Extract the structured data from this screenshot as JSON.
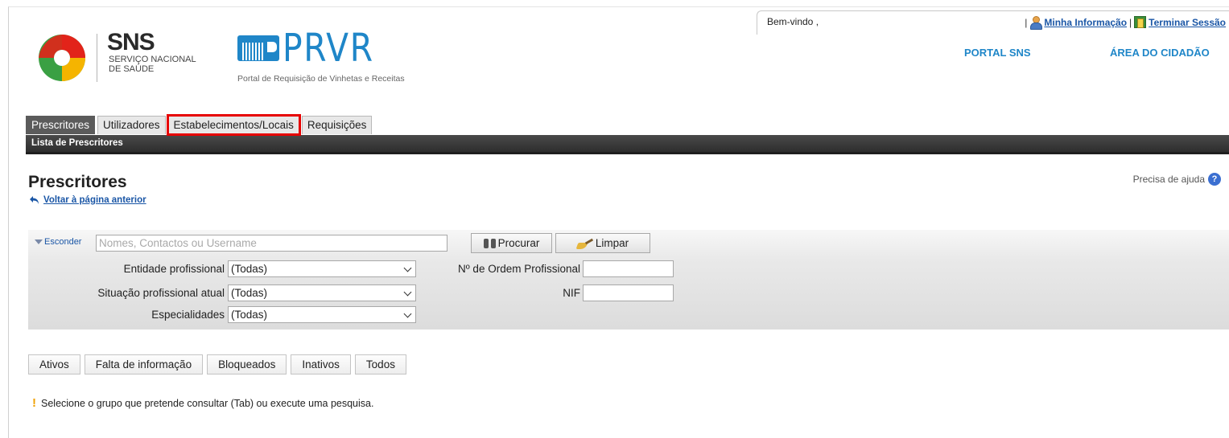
{
  "header": {
    "welcome": "Bem-vindo ,",
    "separator": "|",
    "my_info": "Minha Informação",
    "logout": "Terminar Sessão",
    "portal_sns": "PORTAL SNS",
    "area_cidadao": "ÁREA DO CIDADÃO"
  },
  "brand": {
    "sns_big": "SNS",
    "sns_line1": "SERVIÇO NACIONAL",
    "sns_line2": "DE SAÚDE",
    "prvr_word": "PRVR",
    "prvr_subtitle": "Portal de Requisição de Vinhetas e Receitas",
    "colors": {
      "primary_blue": "#1f86c8",
      "logo_green": "#3aa043",
      "logo_red": "#e2231a",
      "logo_yellow": "#f5b400"
    }
  },
  "nav": {
    "tabs": [
      {
        "label": "Prescritores",
        "active": true
      },
      {
        "label": "Utilizadores",
        "active": false
      },
      {
        "label": "Estabelecimentos/Locais",
        "active": false,
        "highlighted": true
      },
      {
        "label": "Requisições",
        "active": false
      }
    ],
    "subnav": "Lista de Prescritores"
  },
  "page": {
    "title": "Prescritores",
    "back_link": "Voltar à página anterior",
    "help": "Precisa de ajuda"
  },
  "search": {
    "toggle_label": "Esconder",
    "placeholder": "Nomes, Contactos ou Username",
    "search_button": "Procurar",
    "clear_button": "Limpar",
    "fields": {
      "entidade_label": "Entidade profissional",
      "entidade_value": "(Todas)",
      "situacao_label": "Situação profissional atual",
      "situacao_value": "(Todas)",
      "especialidades_label": "Especialidades",
      "especialidades_value": "(Todas)",
      "ordem_label": "Nº de Ordem Profissional",
      "nif_label": "NIF"
    }
  },
  "groups": {
    "tabs": [
      "Ativos",
      "Falta de informação",
      "Bloqueados",
      "Inativos",
      "Todos"
    ]
  },
  "notice": {
    "icon": "!",
    "text": "Selecione o grupo que pretende consultar (Tab) ou execute uma pesquisa."
  }
}
